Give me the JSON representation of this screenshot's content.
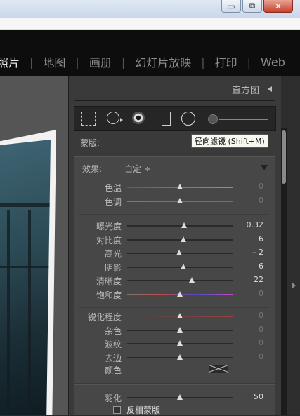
{
  "window": {
    "minimize": "▭",
    "restore": "⧉",
    "close": "✕"
  },
  "modules": [
    "照片",
    "地图",
    "画册",
    "幻灯片放映",
    "打印",
    "Web"
  ],
  "panel": {
    "histogram_title": "直方图",
    "tooltip": "径向滤镜 (Shift+M)",
    "mask_label": "蒙版:",
    "effect_label": "效果:",
    "effect_value": "自定 ÷",
    "sliders_group1": [
      {
        "label": "色温",
        "value": "0",
        "pos": 0.5,
        "track": "blue-yellow"
      },
      {
        "label": "色调",
        "value": "0",
        "pos": 0.5,
        "track": "green-magenta"
      }
    ],
    "sliders_group2": [
      {
        "label": "曝光度",
        "value": "0.32",
        "pos": 0.54
      },
      {
        "label": "对比度",
        "value": "6",
        "pos": 0.53
      },
      {
        "label": "高光",
        "value": "– 2",
        "pos": 0.49
      },
      {
        "label": "阴影",
        "value": "6",
        "pos": 0.53
      },
      {
        "label": "清晰度",
        "value": "22",
        "pos": 0.61
      },
      {
        "label": "饱和度",
        "value": "0",
        "pos": 0.5,
        "track": "saturation"
      }
    ],
    "sliders_group3": [
      {
        "label": "锐化程度",
        "value": "0",
        "pos": 0.5,
        "track": "sharp"
      },
      {
        "label": "杂色",
        "value": "0",
        "pos": 0.5
      },
      {
        "label": "波纹",
        "value": "0",
        "pos": 0.5
      },
      {
        "label": "去边",
        "value": "0",
        "pos": 0.5
      }
    ],
    "color_label": "颜色",
    "feather_label": "羽化",
    "feather_value": "50",
    "feather_pos": 0.5,
    "invert_label": "反相蒙版"
  },
  "colors": {
    "accent_active": "#e8e8e8",
    "panel_bg": "#3a3a3a",
    "sub_bg": "#474747"
  }
}
